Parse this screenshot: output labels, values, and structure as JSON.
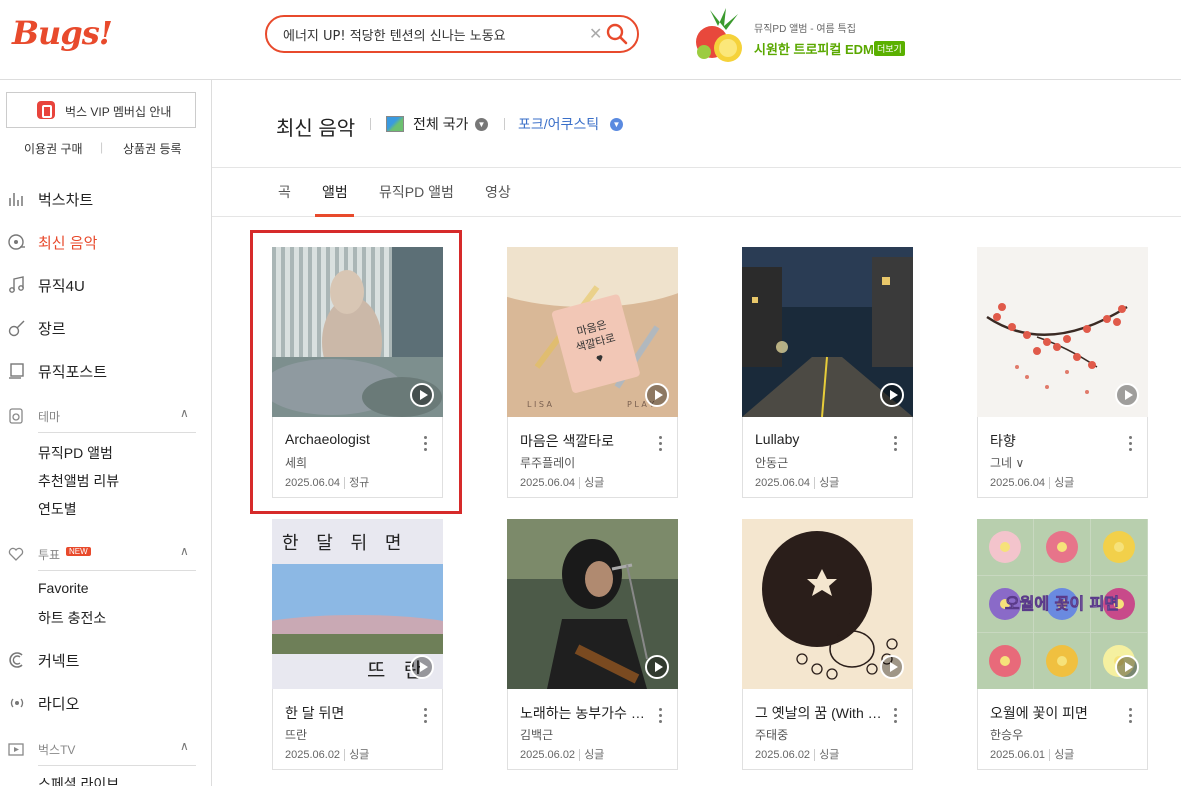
{
  "app": {
    "logo": "Bugs!"
  },
  "search": {
    "value": "에너지 UP! 적당한 텐션의 신나는 노동요",
    "clear_glyph": "✕"
  },
  "promo": {
    "sub": "뮤직PD 앨범 - 여름 특집",
    "main": "시원한 트로피컬 EDM",
    "more": "더보기"
  },
  "sidebar": {
    "vip": "벅스 VIP 멤버십 안내",
    "buy": "이용권 구매",
    "register": "상품권 등록",
    "nav": [
      {
        "label": "벅스차트",
        "icon": "chart-icon"
      },
      {
        "label": "최신 음악",
        "icon": "new-music-icon",
        "active": true
      },
      {
        "label": "뮤직4U",
        "icon": "music-note-icon"
      },
      {
        "label": "장르",
        "icon": "guitar-icon"
      },
      {
        "label": "뮤직포스트",
        "icon": "post-icon"
      }
    ],
    "theme": {
      "label": "테마",
      "items": [
        "뮤직PD 앨범",
        "추천앨범 리뷰",
        "연도별"
      ]
    },
    "vote": {
      "label": "투표",
      "badge": "NEW",
      "items": [
        "Favorite",
        "하트 충전소"
      ]
    },
    "connect": "커넥트",
    "radio": "라디오",
    "tv": {
      "label": "벅스TV",
      "items": [
        "스페셜 라이브"
      ]
    }
  },
  "main": {
    "title": "최신 음악",
    "country": "전체 국가",
    "genre": "포크/어쿠스틱",
    "tabs": [
      "곡",
      "앨범",
      "뮤직PD 앨범",
      "영상"
    ],
    "active_tab": 1
  },
  "albums": [
    {
      "title": "Archaeologist",
      "artist": "세희",
      "date": "2025.06.04",
      "type": "정규"
    },
    {
      "title": "마음은 색깔타로",
      "artist": "루주플레이",
      "date": "2025.06.04",
      "type": "싱글",
      "cover_text": "마음은 색깔타로",
      "cover_sub": "L I S A  P L A Y"
    },
    {
      "title": "Lullaby",
      "artist": "안동근",
      "date": "2025.06.04",
      "type": "싱글"
    },
    {
      "title": "타향",
      "artist": "그네",
      "date": "2025.06.04",
      "type": "싱글",
      "artist_more": "∨"
    },
    {
      "title": "한 달 뒤면",
      "artist": "뜨란",
      "date": "2025.06.02",
      "type": "싱글",
      "cover_top": "한 달 뒤 면",
      "cover_bottom": "뜨 란"
    },
    {
      "title": "노래하는 농부가수 Vol...",
      "artist": "김백근",
      "date": "2025.06.02",
      "type": "싱글"
    },
    {
      "title": "그 옛날의 꿈 (With 이...",
      "artist": "주태중",
      "date": "2025.06.02",
      "type": "싱글"
    },
    {
      "title": "오월에 꽃이 피면",
      "artist": "한승우",
      "date": "2025.06.01",
      "type": "싱글",
      "cover_text": "오월에 꽃이 피면"
    }
  ]
}
